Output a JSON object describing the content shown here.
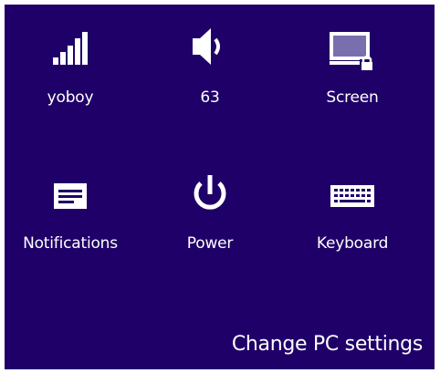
{
  "panel": {
    "background": "#1f0068",
    "text_color": "#ffffff"
  },
  "tiles": [
    {
      "label": "yoboy",
      "icon": "wifi-signal-icon"
    },
    {
      "label": "63",
      "icon": "speaker-volume-icon"
    },
    {
      "label": "Screen",
      "icon": "screen-lock-icon"
    },
    {
      "label": "Notifications",
      "icon": "notifications-icon"
    },
    {
      "label": "Power",
      "icon": "power-icon"
    },
    {
      "label": "Keyboard",
      "icon": "keyboard-icon"
    }
  ],
  "change_pc_settings": "Change PC settings"
}
